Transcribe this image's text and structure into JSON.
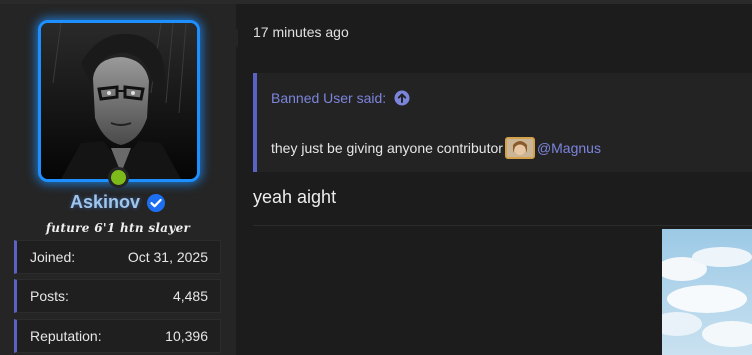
{
  "user": {
    "username": "Askinov",
    "title": "future 6'1 htn slayer",
    "stats": [
      {
        "label": "Joined:",
        "value": "Oct 31, 2025"
      },
      {
        "label": "Posts:",
        "value": "4,485"
      },
      {
        "label": "Reputation:",
        "value": "10,396"
      }
    ]
  },
  "post": {
    "timestamp": "17 minutes ago",
    "quote": {
      "author_label": "Banned User said:",
      "text": "they just be giving anyone contributor",
      "mention": "@Magnus"
    },
    "reply_text": "yeah aight"
  },
  "colors": {
    "accent": "#5a63c4",
    "link": "#7c85dc",
    "avatar_glow": "#1d8fff",
    "online": "#7dbb1a",
    "verified": "#1d6ff2"
  },
  "icons": {
    "verified": "verified-badge-icon",
    "quote_jump": "arrow-up-circle-icon"
  }
}
